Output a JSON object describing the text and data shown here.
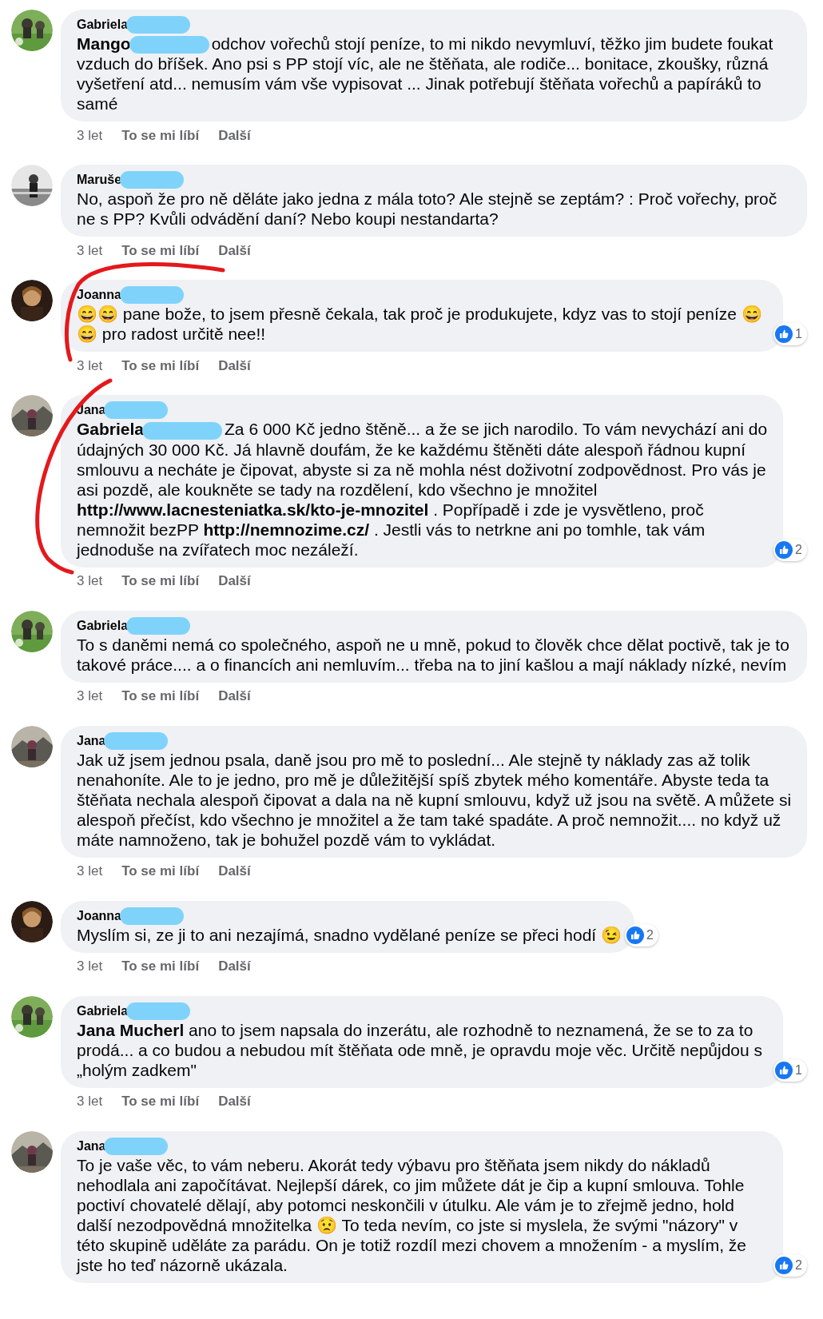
{
  "comments": [
    {
      "author": "Gabriela",
      "author_redacted": true,
      "mention": "Mango",
      "mention_redacted": true,
      "text": "odchov vořechů stojí peníze, to mi nikdo nevymluví, těžko jim budete foukat vzduch do bříšek. Ano psi s PP stojí víc, ale ne štěňata, ale rodiče... bonitace, zkoušky, různá vyšetření atd... nemusím vám vše vypisovat ... Jinak potřebují štěňata vořechů a papíráků to samé",
      "meta": {
        "time": "3 let",
        "like": "To se mi líbí",
        "more": "Další"
      }
    },
    {
      "author": "Maruše",
      "author_redacted": true,
      "text": "No, aspoň že pro ně děláte jako jedna z mála toto? Ale stejně se zeptám? : Proč vořechy, proč ne s PP? Kvůli odvádění daní? Nebo koupi nestandarta?",
      "meta": {
        "time": "3 let",
        "like": "To se mi líbí",
        "more": "Další"
      }
    },
    {
      "author": "Joanna",
      "author_redacted": true,
      "text": "😄😄 pane bože, to jsem přesně čekala, tak proč je produkujete, kdyz vas to stojí peníze 😄😄 pro radost určitě nee!!",
      "likes": "1",
      "meta": {
        "time": "3 let",
        "like": "To se mi líbí",
        "more": "Další"
      }
    },
    {
      "author": "Jana",
      "author_redacted": true,
      "mention": "Gabriela",
      "mention_redacted": true,
      "text": "Za 6 000 Kč jedno štěně... a že se jich narodilo. To vám nevychází ani do údajných 30 000 Kč. Já hlavně doufám, že ke každému štěněti dáte alespoň řádnou kupní smlouvu a necháte je čipovat, abyste si za ně mohla nést doživotní zodpovědnost. Pro vás je asi pozdě, ale koukněte se tady na rozdělení, kdo všechno je množitel **http://www.lacnesteniatka.sk/kto-je-mnozitel** . Popřípadě i zde je vysvětleno, proč nemnožit bezPP **http://nemnozime.cz/** . Jestli vás to netrkne ani po tomhle, tak vám jednoduše na zvířatech moc nezáleží.",
      "likes": "2",
      "meta": {
        "time": "3 let",
        "like": "To se mi líbí",
        "more": "Další"
      }
    },
    {
      "author": "Gabriela",
      "author_redacted": true,
      "text": "To s daněmi nemá co společného, aspoň ne u mně, pokud to člověk chce dělat poctivě, tak je to takové práce.... a o financích ani nemluvím... třeba na to jiní kašlou a mají náklady nízké, nevím",
      "meta": {
        "time": "3 let",
        "like": "To se mi líbí",
        "more": "Další"
      }
    },
    {
      "author": "Jana",
      "author_redacted": true,
      "text": "Jak už jsem jednou psala, daně jsou pro mě to poslední... Ale stejně ty náklady zas až tolik nenahoníte. Ale to je jedno, pro mě je důležitější spíš zbytek mého komentáře. Abyste teda ta štěňata nechala alespoň čipovat a dala na ně kupní smlouvu, když už jsou na světě. A můžete si alespoň přečíst, kdo všechno je množitel a že tam také spadáte. A proč nemnožit.... no když už máte namnoženo, tak je bohužel pozdě vám to vykládat.",
      "meta": {
        "time": "3 let",
        "like": "To se mi líbí",
        "more": "Další"
      }
    },
    {
      "author": "Joanna",
      "author_redacted": true,
      "text": "Myslím si, ze ji to ani nezajímá, snadno vydělané peníze se přeci hodí 😉",
      "likes": "2",
      "meta": {
        "time": "3 let",
        "like": "To se mi líbí",
        "more": "Další"
      }
    },
    {
      "author": "Gabriela",
      "author_redacted": true,
      "mention": "Jana Mucherl",
      "mention_redacted": false,
      "text": "ano to jsem napsala do inzerátu, ale rozhodně to neznamená, že se to za to prodá... a co budou a nebudou mít štěňata ode mně, je opravdu moje věc. Určitě nepůjdou s „holým zadkem\"",
      "likes": "1",
      "meta": {
        "time": "3 let",
        "like": "To se mi líbí",
        "more": "Další"
      }
    },
    {
      "author": "Jana",
      "author_redacted": true,
      "text": "To je vaše věc, to vám neberu. Akorát tedy výbavu pro štěňata jsem nikdy do nákladů nehodlala ani započítávat. Nejlepší dárek, co jim můžete dát je čip a kupní smlouva. Tohle poctiví chovatelé dělají, aby potomci neskončili v útulku. Ale vám je to zřejmě jedno, hold další nezodpovědná množitelka 😟 To teda nevím, co jste si myslela, že svými \"názory\" v této skupině uděláte za parádu. On je totiž rozdíl mezi chovem a množením - a myslím, že jste ho teď názorně ukázala.",
      "likes": "2"
    }
  ]
}
